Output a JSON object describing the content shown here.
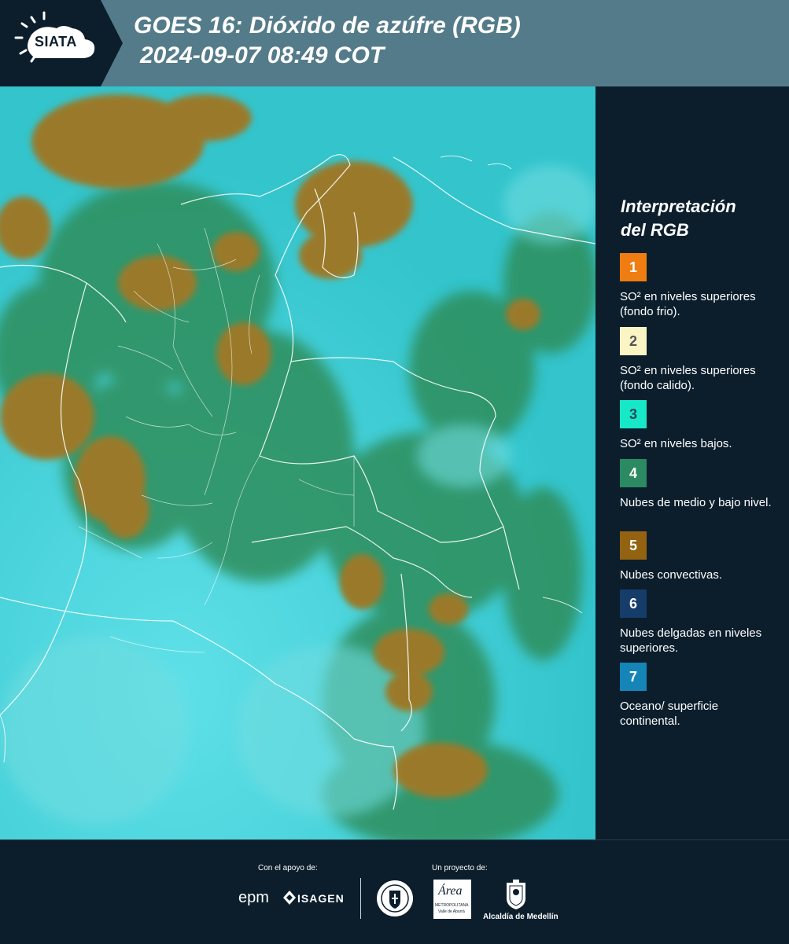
{
  "header": {
    "logo_text": "SIATA",
    "title_line1": "GOES 16: Dióxido de azúfre (RGB)",
    "title_line2": "2024-09-07 08:49 COT"
  },
  "legend": {
    "title_line1": "Interpretación",
    "title_line2": "del RGB",
    "items": [
      {
        "number": "1",
        "color": "#f07d12",
        "text_color": "#ffffff",
        "label": "SO² en niveles superiores (fondo frio)."
      },
      {
        "number": "2",
        "color": "#fbf4c4",
        "text_color": "#555555",
        "label": "SO² en niveles superiores (fondo calido)."
      },
      {
        "number": "3",
        "color": "#17e8c7",
        "text_color": "#2a4a5a",
        "label": "SO² en niveles bajos."
      },
      {
        "number": "4",
        "color": "#2b8a62",
        "text_color": "#ffffff",
        "label": "Nubes de medio y bajo nivel."
      },
      {
        "number": "5",
        "color": "#936312",
        "text_color": "#ffffff",
        "label": "Nubes convectivas."
      },
      {
        "number": "6",
        "color": "#163c6a",
        "text_color": "#ffffff",
        "label": "Nubes delgadas en niveles superiores."
      },
      {
        "number": "7",
        "color": "#1585b8",
        "text_color": "#ffffff",
        "label": "Oceano/ superficie continental."
      }
    ]
  },
  "footer": {
    "support_label": "Con el apoyo de:",
    "project_label": "Un proyecto de:",
    "epm": "epm",
    "isagen": "ISAGEN",
    "area_name": "Área",
    "area_sub": "METROPOLITANA",
    "area_sub2": "Valle de Aburrá",
    "alcaldia": "Alcaldía de Medellín"
  },
  "map_colors": {
    "base_cyan": "#3fd0d6",
    "green": "#2f8e5c",
    "brown": "#9a7a2a",
    "border": "#ffffff"
  }
}
